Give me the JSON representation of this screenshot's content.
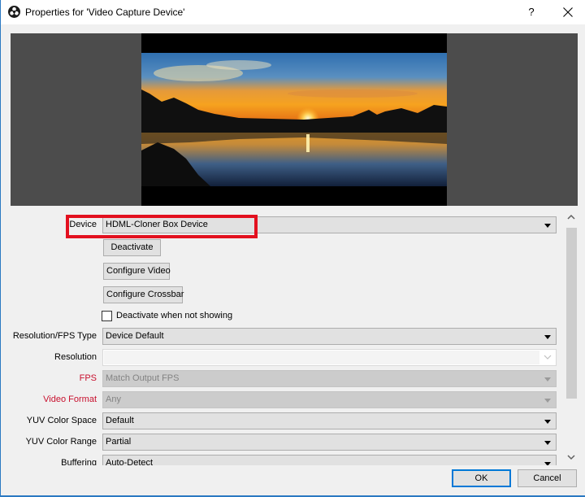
{
  "window": {
    "title": "Properties for 'Video Capture Device'",
    "help_label": "?",
    "app_icon": "obs-logo-icon",
    "close_icon": "close-icon"
  },
  "preview": {
    "content": "sunset-over-lake-image"
  },
  "properties": {
    "device": {
      "label": "Device",
      "value": "HDML-Cloner Box Device"
    },
    "deactivate_button": "Deactivate",
    "configure_video_button": "Configure Video",
    "configure_crossbar_button": "Configure Crossbar",
    "deactivate_when_not_showing": {
      "label": "Deactivate when not showing",
      "checked": false
    },
    "resolution_fps_type": {
      "label": "Resolution/FPS Type",
      "value": "Device Default"
    },
    "resolution": {
      "label": "Resolution",
      "value": ""
    },
    "fps": {
      "label": "FPS",
      "value": "Match Output FPS"
    },
    "video_format": {
      "label": "Video Format",
      "value": "Any"
    },
    "yuv_color_space": {
      "label": "YUV Color Space",
      "value": "Default"
    },
    "yuv_color_range": {
      "label": "YUV Color Range",
      "value": "Partial"
    },
    "buffering": {
      "label": "Buffering",
      "value": "Auto-Detect"
    }
  },
  "colors": {
    "highlight": "#e3101f",
    "warning_label": "#c8102e",
    "accent": "#0078d7"
  },
  "footer": {
    "ok_label": "OK",
    "cancel_label": "Cancel"
  }
}
